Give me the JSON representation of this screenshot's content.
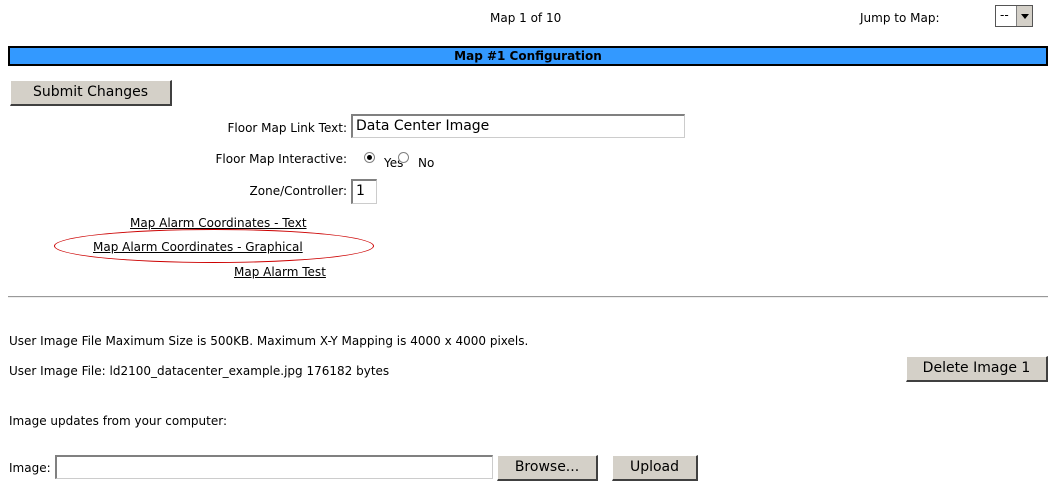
{
  "header": {
    "map_counter": "Map 1 of 10",
    "jump_label": "Jump to Map:",
    "jump_value": "--"
  },
  "section": {
    "title": "Map #1 Configuration"
  },
  "form": {
    "submit_label": "Submit Changes",
    "link_text_label": "Floor Map Link Text:",
    "link_text_value": "Data Center Image",
    "interactive_label": "Floor Map Interactive:",
    "interactive_yes": "Yes",
    "interactive_no": "No",
    "interactive_selected": "Yes",
    "zone_label": "Zone/Controller:",
    "zone_value": "1"
  },
  "links": {
    "coords_text": "Map Alarm Coordinates - Text",
    "coords_graphical": "Map Alarm Coordinates - Graphical",
    "alarm_test": "Map Alarm Test"
  },
  "image_section": {
    "max_info": "User Image File Maximum Size is 500KB. Maximum X-Y Mapping is 4000 x 4000 pixels.",
    "file_info": "User Image File: ld2100_datacenter_example.jpg 176182 bytes",
    "delete_label": "Delete Image 1",
    "updates_info": "Image updates from your computer:",
    "image_label": "Image:",
    "image_value": "",
    "browse_label": "Browse...",
    "upload_label": "Upload"
  },
  "colors": {
    "section_bar": "#3399ff",
    "highlight_ellipse": "#cc0000",
    "button_face": "#d4d0c8"
  }
}
